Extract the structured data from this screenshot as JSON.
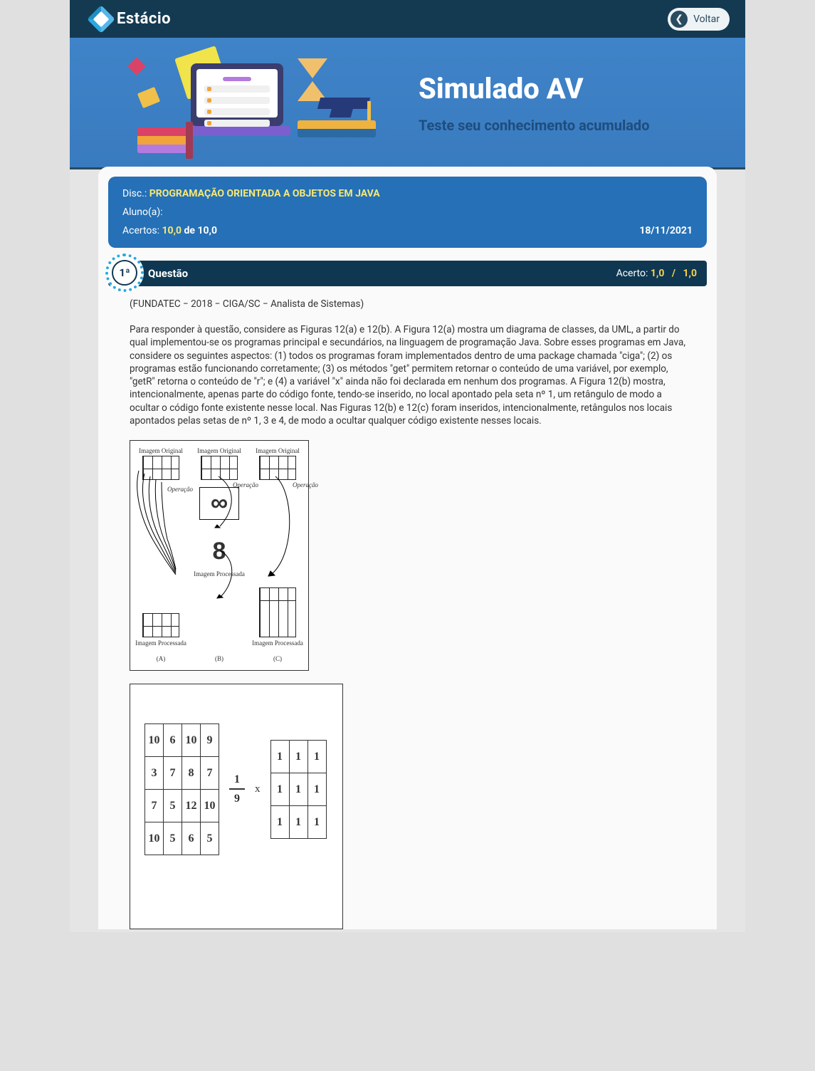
{
  "topbar": {
    "brand": "Estácio",
    "back_label": "Voltar"
  },
  "banner": {
    "title": "Simulado AV",
    "subtitle": "Teste seu conhecimento acumulado"
  },
  "meta": {
    "disc_label": "Disc.:",
    "disc_value": "PROGRAMAÇÃO ORIENTADA A OBJETOS EM JAVA",
    "aluno_label": "Aluno(a):",
    "acertos_label": "Acertos:",
    "acertos_value": "10,0",
    "acertos_de": "de",
    "acertos_total": "10,0",
    "date": "18/11/2021"
  },
  "question": {
    "number": "1ª",
    "title": "Questão",
    "score_label": "Acerto:",
    "score_earned": "1,0",
    "score_sep": "/",
    "score_total": "1,0",
    "source": "(FUNDATEC − 2018 − CIGA/SC − Analista de Sistemas)",
    "text": "Para responder à questão, considere as Figuras 12(a) e 12(b). A Figura 12(a) mostra um diagrama de classes, da UML, a partir do qual implementou-se os programas principal e secundários, na linguagem de programação Java. Sobre esses programas em Java, considere os seguintes aspectos: (1) todos os programas foram implementados dentro de uma package chamada \"ciga\"; (2) os programas estão funcionando corretamente; (3) os métodos \"get\" permitem retornar o conteúdo de uma variável, por exemplo, \"getR\" retorna o conteúdo de \"r\"; e (4) a variável \"x\" ainda não foi declarada em nenhum dos programas. A Figura 12(b) mostra, intencionalmente, apenas parte do código fonte, tendo-se inserido, no local apontado pela seta nº 1, um retângulo de modo a ocultar o código fonte existente nesse local. Nas Figuras 12(b) e 12(c) foram inseridos, intencionalmente, retângulos nos locais apontados pelas setas de nº 1, 3 e 4, de modo a ocultar qualquer código existente nesses locais."
  },
  "fig1": {
    "top_label": "Imagem Original",
    "op_label": "Operação",
    "bottom_label": "Imagem Processada",
    "col_labels": [
      "(A)",
      "(B)",
      "(C)"
    ],
    "symbols": {
      "b": "∞",
      "b2": "8"
    }
  },
  "fig2": {
    "matrixA": [
      [
        "10",
        "6",
        "10",
        "9"
      ],
      [
        "3",
        "7",
        "8",
        "7"
      ],
      [
        "7",
        "5",
        "12",
        "10"
      ],
      [
        "10",
        "5",
        "6",
        "5"
      ]
    ],
    "frac": {
      "num": "1",
      "den": "9"
    },
    "op": "x",
    "matrixB": [
      [
        "1",
        "1",
        "1"
      ],
      [
        "1",
        "1",
        "1"
      ],
      [
        "1",
        "1",
        "1"
      ]
    ]
  }
}
